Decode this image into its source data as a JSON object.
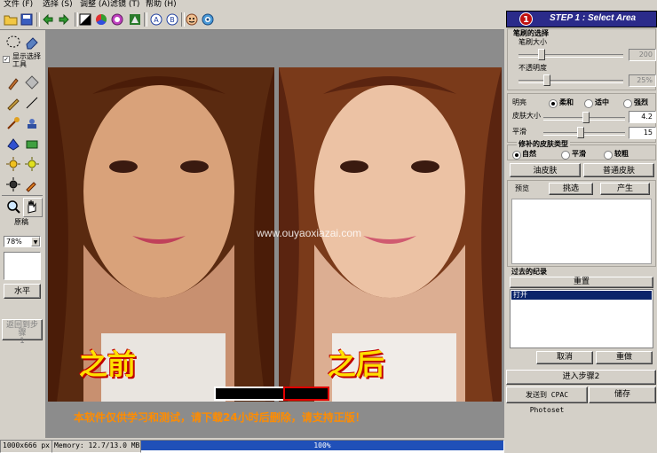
{
  "menubar": {
    "items": [
      {
        "label": "文件",
        "key": "(F)"
      },
      {
        "label": "选择",
        "key": "(S)"
      },
      {
        "label": "调整",
        "key": "(A)"
      },
      {
        "label": "滤镜",
        "key": "(T)"
      },
      {
        "label": "帮助",
        "key": "(H)"
      }
    ]
  },
  "tools": {
    "show_selection_tool": "显示选择工具",
    "original_label": "原稿",
    "zoom_value": "78%",
    "horizontal_button": "水平",
    "back_to_step1_line1": "返回到步骤",
    "back_to_step1_line2": "1"
  },
  "canvas": {
    "before_label": "之前",
    "after_label": "之后",
    "watermark": "www.ouyaoxiazai.com",
    "notice": "本软件仅供学习和测试，请下载24小时后删除，请支持正版！"
  },
  "status": {
    "dimensions": "1000x666 px",
    "memory": "Memory: 12.7/13.0 MB",
    "progress_text": "100%",
    "progress_value": 1.0
  },
  "panel": {
    "step_number": "1",
    "step_title": "STEP 1 : Select Area",
    "brush_section": "笔刷的选择",
    "brush_size_label": "笔刷大小",
    "brush_size_value": "200",
    "opacity_label": "不透明度",
    "opacity_value": "25%",
    "brightness_label": "明亮",
    "brightness_options": [
      "柔和",
      "适中",
      "强烈"
    ],
    "skin_size_label": "皮肤大小",
    "skin_size_value": "4.2",
    "smooth_label": "平滑",
    "smooth_value": "15",
    "skin_type_title": "修补的皮肤类型",
    "skin_type_options": [
      "自然",
      "平滑",
      "较粗"
    ],
    "oily_skin_button": "油皮肤",
    "normal_skin_button": "普通皮肤",
    "preview_label": "预览",
    "pick_button": "挑选",
    "generate_button": "产生",
    "history_title": "过去的纪录",
    "reset_button": "重置",
    "history_items": [
      "打开"
    ],
    "cancel_button": "取消",
    "redo_button": "重做",
    "next_step_button": "进入步骤2",
    "send_button": "发送到 CPAC Photoset",
    "save_button": "储存"
  },
  "colors": {
    "accent": "#0a246a",
    "step_banner": "#2b2b8a",
    "notice_text": "#ff8c00",
    "label_text": "#ffe000"
  }
}
